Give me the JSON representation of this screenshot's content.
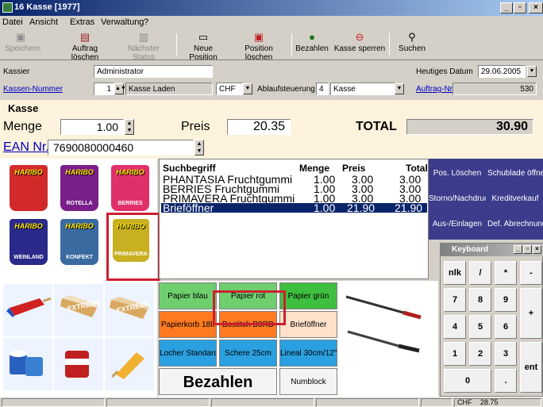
{
  "window": {
    "title": "16 Kasse [1977]"
  },
  "menu": [
    "Datei",
    "Ansicht",
    "Extras",
    "Verwaltung",
    "?"
  ],
  "toolbar": {
    "save": "Speichern",
    "delete_order": "Auftrag löschen",
    "next_status": "Nächster Status",
    "new_position": "Neue Position",
    "delete_position": "Position löschen",
    "pay": "Bezahlen",
    "lock_register": "Kasse sperren",
    "search": "Suchen"
  },
  "header": {
    "cashier_label": "Kassier",
    "cashier_value": "Administrator",
    "date_label": "Heutiges Datum",
    "date_value": "29.06.2005",
    "register_label": "Kassen-Nummer",
    "register_number": "1",
    "register_name": "Kasse Laden",
    "currency": "CHF",
    "flow_label": "Ablaufsteuerung",
    "flow_number": "4",
    "flow_name": "Kasse",
    "order_label": "Auftrag-Nr.",
    "order_value": "530"
  },
  "section_title": "Kasse",
  "entry": {
    "quantity_label": "Menge",
    "quantity_value": "1.00",
    "price_label": "Preis",
    "price_value": "20.35",
    "total_label": "TOTAL",
    "total_value": "30.90",
    "ean_label": "EAN Nr.",
    "ean_value": "7690080000460"
  },
  "products": [
    {
      "brand": "HARIBO",
      "name": "",
      "color": "#d22a2a"
    },
    {
      "brand": "HARIBO",
      "name": "ROTELLA",
      "color": "#7a1e8a"
    },
    {
      "brand": "HARIBO",
      "name": "BERRIES",
      "color": "#e0306a"
    },
    {
      "brand": "HARIBO",
      "name": "WEINLAND",
      "color": "#2a2a8a"
    },
    {
      "brand": "HARIBO",
      "name": "KONFEKT",
      "color": "#3a6aa0"
    },
    {
      "brand": "HARIBO",
      "name": "PRIMAVERA",
      "color": "#c8b020"
    }
  ],
  "ice_labels": [
    "EXTRÊME",
    "EXTRÊME"
  ],
  "list": {
    "headers": {
      "name": "Suchbegriff",
      "qty": "Menge",
      "price": "Preis",
      "total": "Total"
    },
    "rows": [
      {
        "name": "PHANTASIA Fruchtgummi",
        "qty": "1.00",
        "price": "3.00",
        "total": "3.00"
      },
      {
        "name": "BERRIES Fruchtgummi",
        "qty": "1.00",
        "price": "3.00",
        "total": "3.00"
      },
      {
        "name": "PRIMAVERA Fruchtgummi",
        "qty": "1.00",
        "price": "3.00",
        "total": "3.00"
      },
      {
        "name": "Brieföffner",
        "qty": "1.00",
        "price": "21.90",
        "total": "21.90"
      }
    ]
  },
  "functions": {
    "delete_pos": "Pos. Löschen",
    "drawer": "Schublade öffnen",
    "storno": "Storno/Nachdruck",
    "credit": "Kreditverkauf",
    "cash_in_out": "Aus-/Einlagen",
    "settlement": "Def. Abrechnung"
  },
  "keyboard": {
    "title": "Keyboard",
    "keys": [
      "nlk",
      "/",
      "*",
      "-",
      "7",
      "8",
      "9",
      "+",
      "4",
      "5",
      "6",
      "1",
      "2",
      "3",
      "ent",
      "0",
      "."
    ]
  },
  "categories": [
    {
      "label": "Papier blau",
      "color": "#6fcf6f"
    },
    {
      "label": "Papier rot",
      "color": "#6fcf6f"
    },
    {
      "label": "Papier grün",
      "color": "#3fbf3f"
    },
    {
      "label": "Papierkorb 18lt",
      "color": "#ff7a20"
    },
    {
      "label": "Bostitch B8RD",
      "color": "#ff7a20"
    },
    {
      "label": "Brieföffner",
      "color": "#ffe0c8"
    },
    {
      "label": "Locher Standard",
      "color": "#2aa0e0"
    },
    {
      "label": "Schere 25cm",
      "color": "#2aa0e0"
    },
    {
      "label": "Lineal 30cm/12\"",
      "color": "#2aa0e0"
    }
  ],
  "pay_button": "Bezahlen",
  "numblock_button": "Numblock",
  "status": {
    "currency": "CHF",
    "amount": "28.75"
  }
}
